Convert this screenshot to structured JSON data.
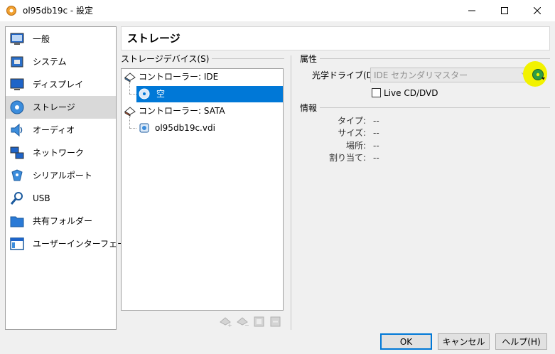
{
  "window": {
    "title": "ol95db19c - 設定",
    "app_icon": "virtualbox-gear-icon",
    "controls": {
      "minimize": "minimize-icon",
      "maximize": "maximize-icon",
      "close": "close-icon"
    }
  },
  "sidebar": {
    "items": [
      {
        "label": "一般",
        "icon": "general-icon",
        "selected": false
      },
      {
        "label": "システム",
        "icon": "system-chip-icon",
        "selected": false
      },
      {
        "label": "ディスプレイ",
        "icon": "display-monitor-icon",
        "selected": false
      },
      {
        "label": "ストレージ",
        "icon": "storage-disc-icon",
        "selected": true
      },
      {
        "label": "オーディオ",
        "icon": "audio-speaker-icon",
        "selected": false
      },
      {
        "label": "ネットワーク",
        "icon": "network-icon",
        "selected": false
      },
      {
        "label": "シリアルポート",
        "icon": "serial-port-icon",
        "selected": false
      },
      {
        "label": "USB",
        "icon": "usb-icon",
        "selected": false
      },
      {
        "label": "共有フォルダー",
        "icon": "shared-folder-icon",
        "selected": false
      },
      {
        "label": "ユーザーインターフェース",
        "icon": "user-interface-icon",
        "selected": false
      }
    ]
  },
  "header": {
    "title": "ストレージ"
  },
  "storage": {
    "group_label": "ストレージデバイス(S)",
    "tree": [
      {
        "label": "コントローラー: IDE",
        "icon": "ide-controller-icon",
        "level": 0
      },
      {
        "label": "空",
        "icon": "optical-disc-icon",
        "level": 1,
        "selected": true
      },
      {
        "label": "コントローラー: SATA",
        "icon": "sata-controller-icon",
        "level": 0
      },
      {
        "label": "ol95db19c.vdi",
        "icon": "hard-disk-icon",
        "level": 1
      }
    ],
    "toolbar": [
      "add-attachment-icon",
      "remove-attachment-icon",
      "add-controller-icon",
      "remove-controller-icon"
    ]
  },
  "attributes": {
    "group_label": "属性",
    "optical_drive_label": "光学ドライブ(D):",
    "optical_drive_value": "IDE セカンダリマスター",
    "choose_disk_icon": "choose-disc-icon",
    "live_cd_label": "Live CD/DVD",
    "live_cd_checked": false
  },
  "information": {
    "group_label": "情報",
    "rows": [
      {
        "key": "タイプ:",
        "value": "--"
      },
      {
        "key": "サイズ:",
        "value": "--"
      },
      {
        "key": "場所:",
        "value": "--"
      },
      {
        "key": "割り当て:",
        "value": "--"
      }
    ]
  },
  "buttons": {
    "ok": "OK",
    "cancel": "キャンセル",
    "help": "ヘルプ(H)"
  },
  "colors": {
    "selection": "#0078d7",
    "highlight": "#f2f200",
    "sidebar_selected": "#d9d9d9"
  }
}
